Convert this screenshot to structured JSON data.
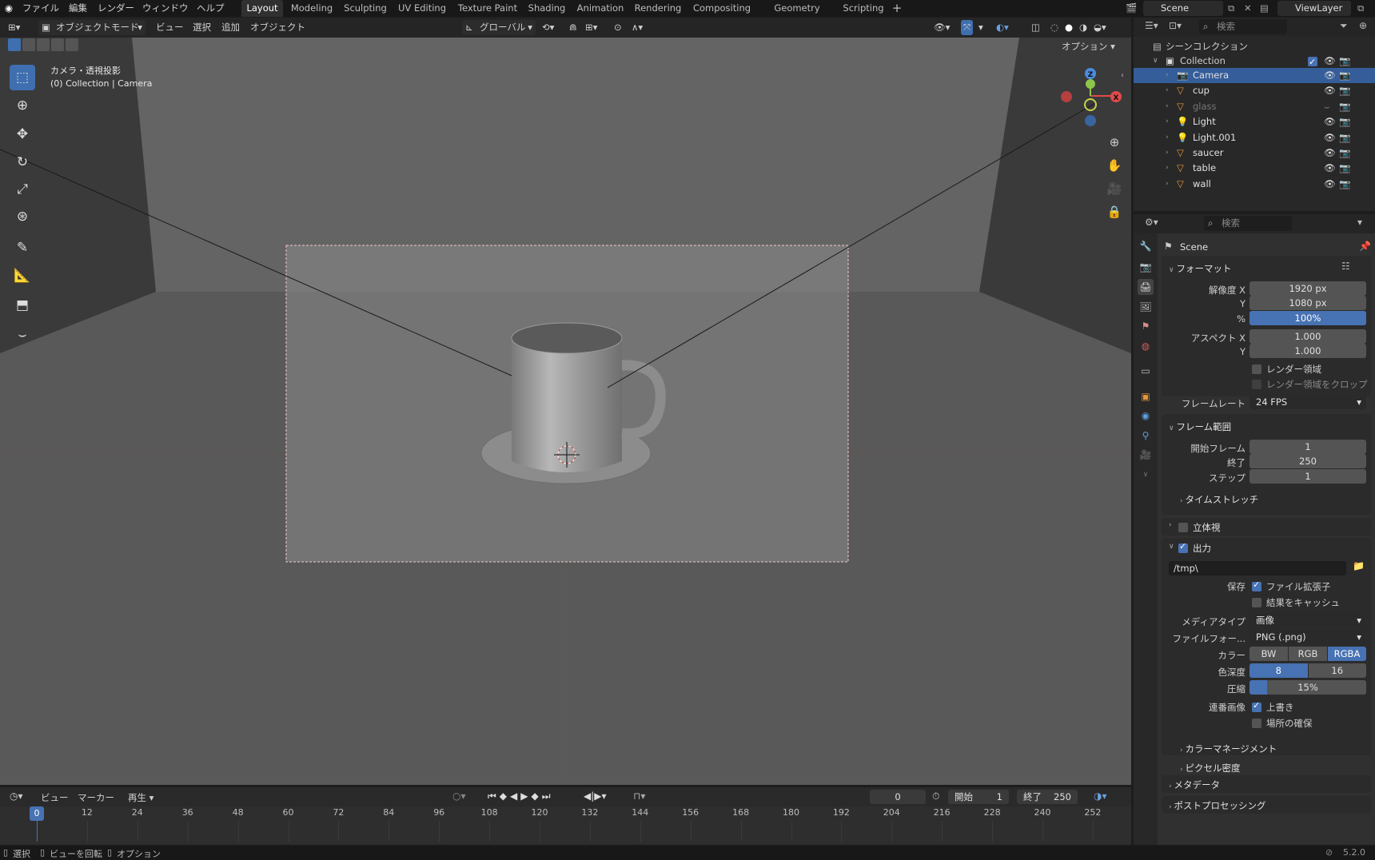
{
  "topbar": {
    "menus": [
      "ファイル",
      "編集",
      "レンダー",
      "ウィンドウ",
      "ヘルプ"
    ],
    "workspaces": [
      "Layout",
      "Modeling",
      "Sculpting",
      "UV Editing",
      "Texture Paint",
      "Shading",
      "Animation",
      "Rendering",
      "Compositing",
      "Geometry Nodes",
      "Scripting"
    ],
    "active_workspace": "Layout",
    "scene": "Scene",
    "view_layer": "ViewLayer"
  },
  "viewport_header": {
    "mode": "オブジェクトモード",
    "menus": [
      "ビュー",
      "選択",
      "追加",
      "オブジェクト"
    ],
    "orientation": "グローバル",
    "options": "オプション"
  },
  "viewport": {
    "view_name": "カメラ・透視投影",
    "view_info": "(0) Collection | Camera"
  },
  "outliner": {
    "search_placeholder": "検索",
    "scene_collection": "シーンコレクション",
    "collection": "Collection",
    "items": [
      {
        "name": "Camera",
        "selected": true
      },
      {
        "name": "cup",
        "selected": false
      },
      {
        "name": "glass",
        "selected": false,
        "hidden": true
      },
      {
        "name": "Light",
        "selected": false
      },
      {
        "name": "Light.001",
        "selected": false
      },
      {
        "name": "saucer",
        "selected": false
      },
      {
        "name": "table",
        "selected": false
      },
      {
        "name": "wall",
        "selected": false
      }
    ]
  },
  "properties": {
    "search_placeholder": "検索",
    "context": "Scene",
    "format": {
      "header": "フォーマット",
      "res_x_label": "解像度 X",
      "res_x": "1920 px",
      "res_y_label": "Y",
      "res_y": "1080 px",
      "pct_label": "%",
      "pct": "100%",
      "aspect_x_label": "アスペクト X",
      "aspect_x": "1.000",
      "aspect_y_label": "Y",
      "aspect_y": "1.000",
      "render_region": "レンダー領域",
      "crop_region": "レンダー領域をクロップ",
      "fps_label": "フレームレート",
      "fps": "24 FPS"
    },
    "frame_range": {
      "header": "フレーム範囲",
      "start_label": "開始フレーム",
      "start": "1",
      "end_label": "終了",
      "end": "250",
      "step_label": "ステップ",
      "step": "1",
      "time_stretch": "タイムストレッチ"
    },
    "stereo": "立体視",
    "output": {
      "header": "出力",
      "path": "/tmp\\",
      "save_label": "保存",
      "file_ext": "ファイル拡張子",
      "cache": "結果をキャッシュ",
      "media_label": "メディアタイプ",
      "media": "画像",
      "format_label": "ファイルフォー...",
      "format": "PNG (.png)",
      "color_label": "カラー",
      "color_opts": [
        "BW",
        "RGB",
        "RGBA"
      ],
      "color_active": "RGBA",
      "depth_label": "色深度",
      "depth_opts": [
        "8",
        "16"
      ],
      "depth_active": "8",
      "compress_label": "圧縮",
      "compress": "15%",
      "compress_fraction": 0.15,
      "seq_label": "連番画像",
      "overwrite": "上書き",
      "placeholders": "場所の確保",
      "color_mgmt": "カラーマネージメント",
      "pixel_density": "ピクセル密度"
    },
    "metadata": "メタデータ",
    "post": "ポストプロセッシング"
  },
  "timeline": {
    "menus": [
      "ビュー",
      "マーカー",
      "再生"
    ],
    "current": "0",
    "start_label": "開始",
    "start": "1",
    "end_label": "終了",
    "end": "250",
    "ticks": [
      "0",
      "12",
      "24",
      "36",
      "48",
      "60",
      "72",
      "84",
      "96",
      "108",
      "120",
      "132",
      "144",
      "156",
      "168",
      "180",
      "192",
      "204",
      "216",
      "228",
      "240",
      "252"
    ]
  },
  "statusbar": {
    "items": [
      "選択",
      "ビューを回転",
      "オプション"
    ],
    "version": "5.2.0"
  }
}
